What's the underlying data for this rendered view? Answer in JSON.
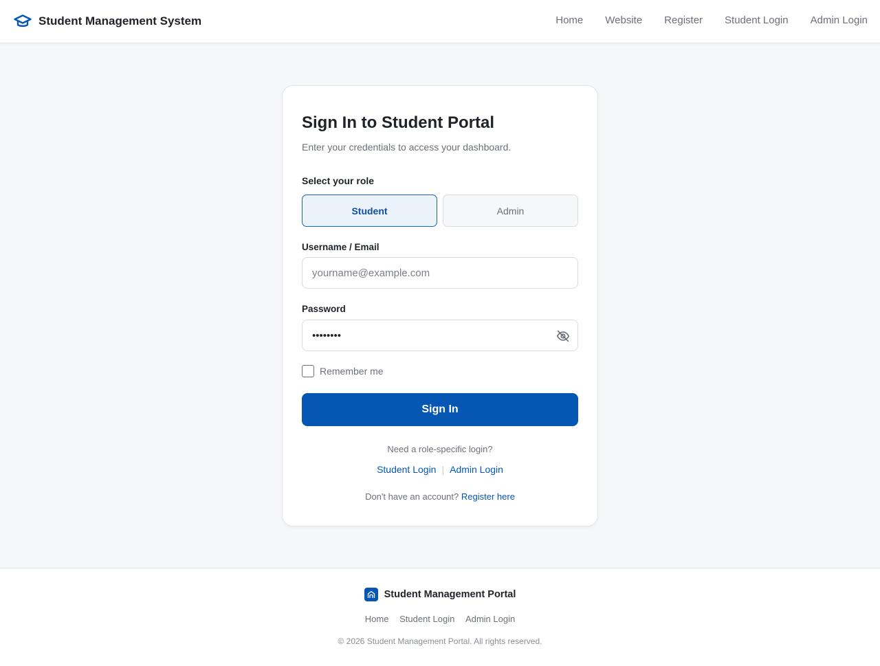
{
  "header": {
    "brand_icon": "graduation-cap-icon",
    "title": "Student Management System",
    "nav": [
      "Home",
      "Website",
      "Register",
      "Student Login",
      "Admin Login"
    ]
  },
  "login": {
    "title": "Sign In to Student Portal",
    "subtitle": "Enter your credentials to access your dashboard.",
    "role_label": "Select your role",
    "roles": [
      "Student",
      "Admin"
    ],
    "selected_role": "Student",
    "username_label": "Username / Email",
    "username_placeholder": "yourname@example.com",
    "username_value": "",
    "password_label": "Password",
    "password_value": "password",
    "password_toggle_icon": "eye-off-icon",
    "remember_label": "Remember me",
    "remember_checked": false,
    "submit_label": "Sign In",
    "role_prompt": "Need a role-specific login?",
    "student_login_link": "Student Login",
    "admin_login_link": "Admin Login",
    "no_account_text": "Don't have an account?",
    "register_link": "Register here"
  },
  "footer": {
    "logo_icon": "school-icon",
    "title": "Student Management Portal",
    "links": [
      "Home",
      "Student Login",
      "Admin Login"
    ],
    "copyright": "© 2026 Student Management Portal. All rights reserved."
  },
  "colors": {
    "primary": "#0557b3",
    "selected_bg": "#ebf2fa",
    "page_bg": "#f6f7f9"
  }
}
